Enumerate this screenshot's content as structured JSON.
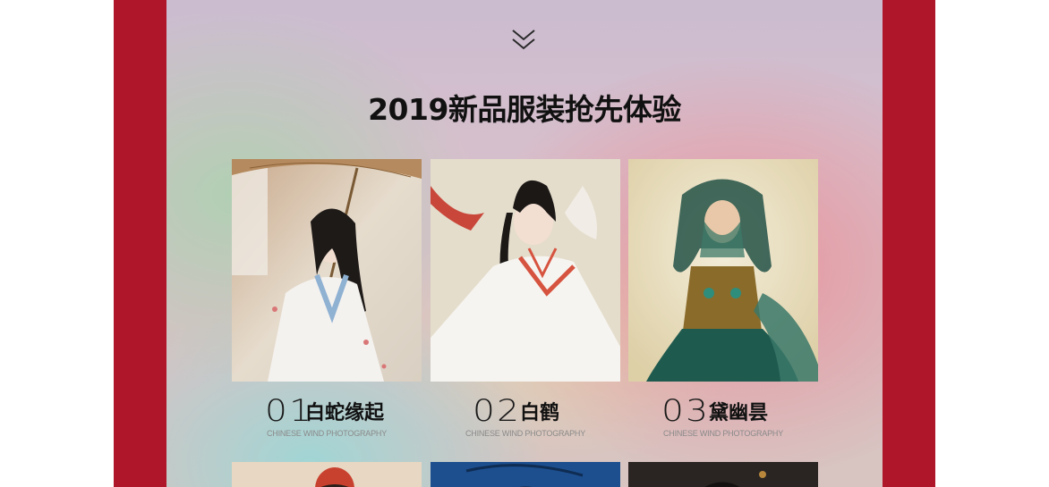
{
  "section": {
    "scroll_icon": "double-chevron-down-icon",
    "title": "2019新品服装抢先体验"
  },
  "colors": {
    "frame_red": "#b0162a",
    "title": "#111111",
    "subtitle_gray": "#8a8a8a"
  },
  "cards": [
    {
      "number": "01",
      "name": "白蛇缘起",
      "subtitle": "CHINESE WIND PHOTOGRAPHY"
    },
    {
      "number": "02",
      "name": "白鹤",
      "subtitle": "CHINESE WIND PHOTOGRAPHY"
    },
    {
      "number": "03",
      "name": "黛幽昙",
      "subtitle": "CHINESE WIND PHOTOGRAPHY"
    }
  ]
}
